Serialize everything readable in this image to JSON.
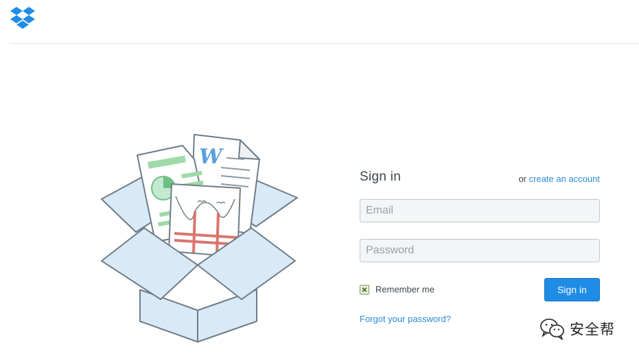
{
  "header": {
    "logo_icon": "dropbox-logo-icon",
    "brand_color": "#1f8ce6"
  },
  "illustration": {
    "icon": "open-box-with-documents-illustration"
  },
  "signin": {
    "title": "Sign in",
    "or_text": "or",
    "create_account_link": "create an account",
    "email_placeholder": "Email",
    "password_placeholder": "Password",
    "remember_label": "Remember me",
    "remember_checked": true,
    "submit_label": "Sign in",
    "forgot_link": "Forgot your password?"
  },
  "watermark": {
    "icon": "wechat-icon",
    "text": "安全帮"
  }
}
